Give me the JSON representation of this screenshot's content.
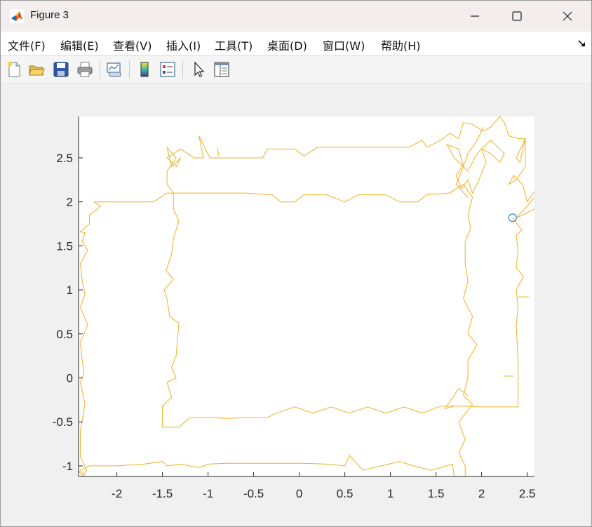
{
  "window": {
    "title": "Figure 3"
  },
  "menu": {
    "items": [
      "文件(F)",
      "编辑(E)",
      "查看(V)",
      "插入(I)",
      "工具(T)",
      "桌面(D)",
      "窗口(W)",
      "帮助(H)"
    ]
  },
  "toolbar": {
    "icons": [
      "new-figure-icon",
      "open-file-icon",
      "save-icon",
      "print-icon",
      "link-plot-icon",
      "colorbar-icon",
      "legend-icon",
      "pointer-icon",
      "property-inspector-icon"
    ]
  },
  "colors": {
    "line": "#EDB120",
    "marker": "#0072BD",
    "axes_bg": "#ffffff",
    "figure_bg": "#f0f0f0"
  },
  "chart_data": {
    "type": "line",
    "xlim": [
      -2.42,
      2.58
    ],
    "ylim": [
      -1.12,
      2.97
    ],
    "xticks": [
      -2,
      -1.5,
      -1,
      -0.5,
      0,
      0.5,
      1,
      1.5,
      2,
      2.5
    ],
    "yticks": [
      -1,
      -0.5,
      0,
      0.5,
      1,
      1.5,
      2,
      2.5
    ],
    "xtick_labels": [
      "-2",
      "-1.5",
      "-1",
      "-0.5",
      "0",
      "0.5",
      "1",
      "1.5",
      "2",
      "2.5"
    ],
    "ytick_labels": [
      "-1",
      "-0.5",
      "0",
      "0.5",
      "1",
      "1.5",
      "2",
      "2.5"
    ],
    "grid": false,
    "series": [
      {
        "points": [
          [
            2.34,
            1.82
          ],
          [
            2.44,
            1.68
          ],
          [
            2.38,
            1.62
          ],
          [
            2.4,
            1.45
          ],
          [
            2.38,
            1.25
          ],
          [
            2.46,
            1.15
          ],
          [
            2.38,
            1.0
          ],
          [
            2.4,
            0.8
          ],
          [
            2.38,
            0.6
          ],
          [
            2.4,
            0.2
          ],
          [
            2.4,
            -0.33
          ],
          [
            2.0,
            -0.33
          ],
          [
            1.8,
            -0.32
          ],
          [
            1.55,
            -0.32
          ],
          [
            1.35,
            -0.4
          ],
          [
            1.15,
            -0.33
          ],
          [
            0.95,
            -0.4
          ],
          [
            0.75,
            -0.33
          ],
          [
            0.55,
            -0.4
          ],
          [
            0.35,
            -0.33
          ],
          [
            0.15,
            -0.4
          ],
          [
            -0.05,
            -0.33
          ],
          [
            -0.25,
            -0.4
          ],
          [
            -0.35,
            -0.45
          ],
          [
            -0.55,
            -0.45
          ],
          [
            -0.8,
            -0.46
          ],
          [
            -1.0,
            -0.45
          ],
          [
            -1.2,
            -0.45
          ],
          [
            -1.32,
            -0.56
          ],
          [
            -1.5,
            -0.56
          ],
          [
            -1.5,
            -0.32
          ],
          [
            -1.4,
            -0.22
          ],
          [
            -1.45,
            -0.05
          ],
          [
            -1.35,
            0.0
          ],
          [
            -1.4,
            0.12
          ],
          [
            -1.35,
            0.25
          ],
          [
            -1.32,
            0.62
          ],
          [
            -1.42,
            0.7
          ],
          [
            -1.45,
            0.9
          ],
          [
            -1.48,
            1.0
          ],
          [
            -1.38,
            1.12
          ],
          [
            -1.46,
            1.22
          ],
          [
            -1.4,
            1.4
          ],
          [
            -1.38,
            1.58
          ],
          [
            -1.32,
            1.78
          ],
          [
            -1.38,
            1.92
          ],
          [
            -1.38,
            2.1
          ],
          [
            -1.2,
            2.1
          ],
          [
            -0.9,
            2.1
          ],
          [
            -0.6,
            2.1
          ],
          [
            -0.3,
            2.08
          ],
          [
            -0.2,
            2.0
          ],
          [
            -0.05,
            2.0
          ],
          [
            0.05,
            2.08
          ],
          [
            0.3,
            2.08
          ],
          [
            0.5,
            2.0
          ],
          [
            0.65,
            2.08
          ],
          [
            0.95,
            2.08
          ],
          [
            1.1,
            2.0
          ],
          [
            1.3,
            2.0
          ],
          [
            1.4,
            2.08
          ],
          [
            1.65,
            2.1
          ],
          [
            1.8,
            2.2
          ],
          [
            1.9,
            2.05
          ],
          [
            1.85,
            1.85
          ],
          [
            1.88,
            1.7
          ],
          [
            1.82,
            1.55
          ],
          [
            1.82,
            1.3
          ],
          [
            1.85,
            1.1
          ],
          [
            1.8,
            0.9
          ],
          [
            1.9,
            0.7
          ],
          [
            1.85,
            0.5
          ],
          [
            1.95,
            0.38
          ],
          [
            1.85,
            0.2
          ],
          [
            1.85,
            0.0
          ],
          [
            1.8,
            -0.2
          ],
          [
            1.9,
            -0.3
          ],
          [
            1.75,
            -0.5
          ],
          [
            1.82,
            -0.7
          ],
          [
            1.75,
            -0.85
          ],
          [
            1.82,
            -1.0
          ],
          [
            1.82,
            -1.12
          ]
        ]
      },
      {
        "points": [
          [
            1.7,
            -1.12
          ],
          [
            1.68,
            -0.98
          ],
          [
            1.45,
            -1.05
          ],
          [
            1.25,
            -1.0
          ],
          [
            1.1,
            -0.95
          ],
          [
            0.9,
            -1.0
          ],
          [
            0.7,
            -1.05
          ],
          [
            0.55,
            -0.88
          ],
          [
            0.5,
            -1.0
          ],
          [
            0.3,
            -0.98
          ],
          [
            0.05,
            -0.97
          ],
          [
            -0.2,
            -0.97
          ],
          [
            -0.5,
            -0.97
          ],
          [
            -0.8,
            -0.97
          ],
          [
            -1.0,
            -0.98
          ],
          [
            -1.1,
            -1.02
          ],
          [
            -1.3,
            -0.98
          ],
          [
            -1.45,
            -1.0
          ],
          [
            -1.5,
            -0.95
          ],
          [
            -1.7,
            -0.98
          ],
          [
            -2.0,
            -1.0
          ],
          [
            -2.3,
            -1.0
          ],
          [
            -2.4,
            -1.05
          ],
          [
            -2.35,
            -1.12
          ]
        ]
      },
      {
        "points": [
          [
            -2.42,
            -1.05
          ],
          [
            -2.38,
            -1.12
          ],
          [
            -2.33,
            -1.05
          ],
          [
            -2.4,
            -0.9
          ],
          [
            -2.4,
            -0.6
          ],
          [
            -2.35,
            -0.3
          ],
          [
            -2.4,
            -0.05
          ],
          [
            -2.36,
            0.05
          ],
          [
            -2.38,
            0.2
          ],
          [
            -2.4,
            0.4
          ],
          [
            -2.32,
            0.6
          ],
          [
            -2.4,
            0.8
          ],
          [
            -2.35,
            0.95
          ],
          [
            -2.38,
            1.1
          ],
          [
            -2.4,
            1.3
          ],
          [
            -2.32,
            1.45
          ],
          [
            -2.38,
            1.55
          ],
          [
            -2.35,
            1.65
          ],
          [
            -2.4,
            1.66
          ],
          [
            -2.3,
            1.75
          ],
          [
            -2.3,
            1.85
          ],
          [
            -2.18,
            1.95
          ],
          [
            -2.25,
            2.0
          ],
          [
            -1.9,
            2.0
          ],
          [
            -1.6,
            2.0
          ],
          [
            -1.45,
            2.1
          ],
          [
            -1.38,
            2.1
          ]
        ]
      },
      {
        "points": [
          [
            -1.38,
            2.1
          ],
          [
            -1.45,
            2.2
          ],
          [
            -1.45,
            2.35
          ],
          [
            -1.35,
            2.5
          ],
          [
            -1.45,
            2.62
          ],
          [
            -1.4,
            2.4
          ],
          [
            -1.3,
            2.5
          ],
          [
            -1.35,
            2.4
          ],
          [
            -1.45,
            2.5
          ],
          [
            -1.3,
            2.6
          ],
          [
            -1.15,
            2.5
          ],
          [
            -1.05,
            2.5
          ],
          [
            -1.1,
            2.75
          ],
          [
            -0.98,
            2.5
          ],
          [
            -0.7,
            2.5
          ],
          [
            -0.4,
            2.5
          ],
          [
            -0.35,
            2.6
          ],
          [
            -0.05,
            2.6
          ],
          [
            0.05,
            2.52
          ],
          [
            0.2,
            2.62
          ],
          [
            0.5,
            2.62
          ],
          [
            0.8,
            2.62
          ],
          [
            1.2,
            2.62
          ],
          [
            1.35,
            2.7
          ],
          [
            1.4,
            2.62
          ],
          [
            1.55,
            2.7
          ],
          [
            1.65,
            2.78
          ],
          [
            1.75,
            2.72
          ],
          [
            1.8,
            2.9
          ],
          [
            1.9,
            2.88
          ],
          [
            2.02,
            2.8
          ],
          [
            2.1,
            2.85
          ],
          [
            2.2,
            2.97
          ],
          [
            2.25,
            2.9
          ],
          [
            2.3,
            2.75
          ],
          [
            2.4,
            2.72
          ],
          [
            2.48,
            2.72
          ],
          [
            2.38,
            2.5
          ],
          [
            2.42,
            2.45
          ],
          [
            2.48,
            2.72
          ],
          [
            2.48,
            2.4
          ],
          [
            2.38,
            2.25
          ],
          [
            2.3,
            2.2
          ],
          [
            2.35,
            2.3
          ],
          [
            2.45,
            2.2
          ],
          [
            2.5,
            2.0
          ],
          [
            2.58,
            2.12
          ]
        ]
      },
      {
        "points": [
          [
            2.02,
            2.85
          ],
          [
            1.95,
            2.7
          ],
          [
            1.85,
            2.55
          ],
          [
            1.82,
            2.45
          ],
          [
            1.72,
            2.3
          ],
          [
            1.78,
            2.15
          ],
          [
            1.85,
            2.25
          ],
          [
            1.9,
            2.1
          ],
          [
            1.95,
            2.2
          ],
          [
            2.05,
            2.45
          ],
          [
            2.0,
            2.6
          ],
          [
            2.1,
            2.55
          ],
          [
            2.2,
            2.45
          ],
          [
            2.25,
            2.55
          ],
          [
            2.1,
            2.7
          ],
          [
            1.95,
            2.55
          ],
          [
            1.85,
            2.35
          ],
          [
            1.7,
            2.5
          ],
          [
            1.62,
            2.65
          ],
          [
            1.75,
            2.6
          ],
          [
            1.8,
            2.4
          ],
          [
            1.72,
            2.2
          ],
          [
            1.85,
            2.05
          ]
        ]
      },
      {
        "points": [
          [
            2.58,
            1.92
          ],
          [
            2.45,
            1.85
          ],
          [
            2.38,
            1.82
          ],
          [
            2.5,
            1.95
          ],
          [
            2.58,
            2.05
          ]
        ]
      },
      {
        "points": [
          [
            2.4,
            0.92
          ],
          [
            2.52,
            0.92
          ]
        ]
      },
      {
        "points": [
          [
            2.25,
            0.02
          ],
          [
            2.35,
            0.02
          ]
        ]
      },
      {
        "points": [
          [
            -0.9,
            2.62
          ],
          [
            -0.88,
            2.52
          ]
        ]
      },
      {
        "points": [
          [
            1.7,
            -0.32
          ],
          [
            1.6,
            -0.35
          ],
          [
            1.75,
            -0.12
          ],
          [
            1.85,
            -0.2
          ]
        ]
      }
    ],
    "marker": {
      "x": 2.34,
      "y": 1.82,
      "style": "circle"
    }
  }
}
